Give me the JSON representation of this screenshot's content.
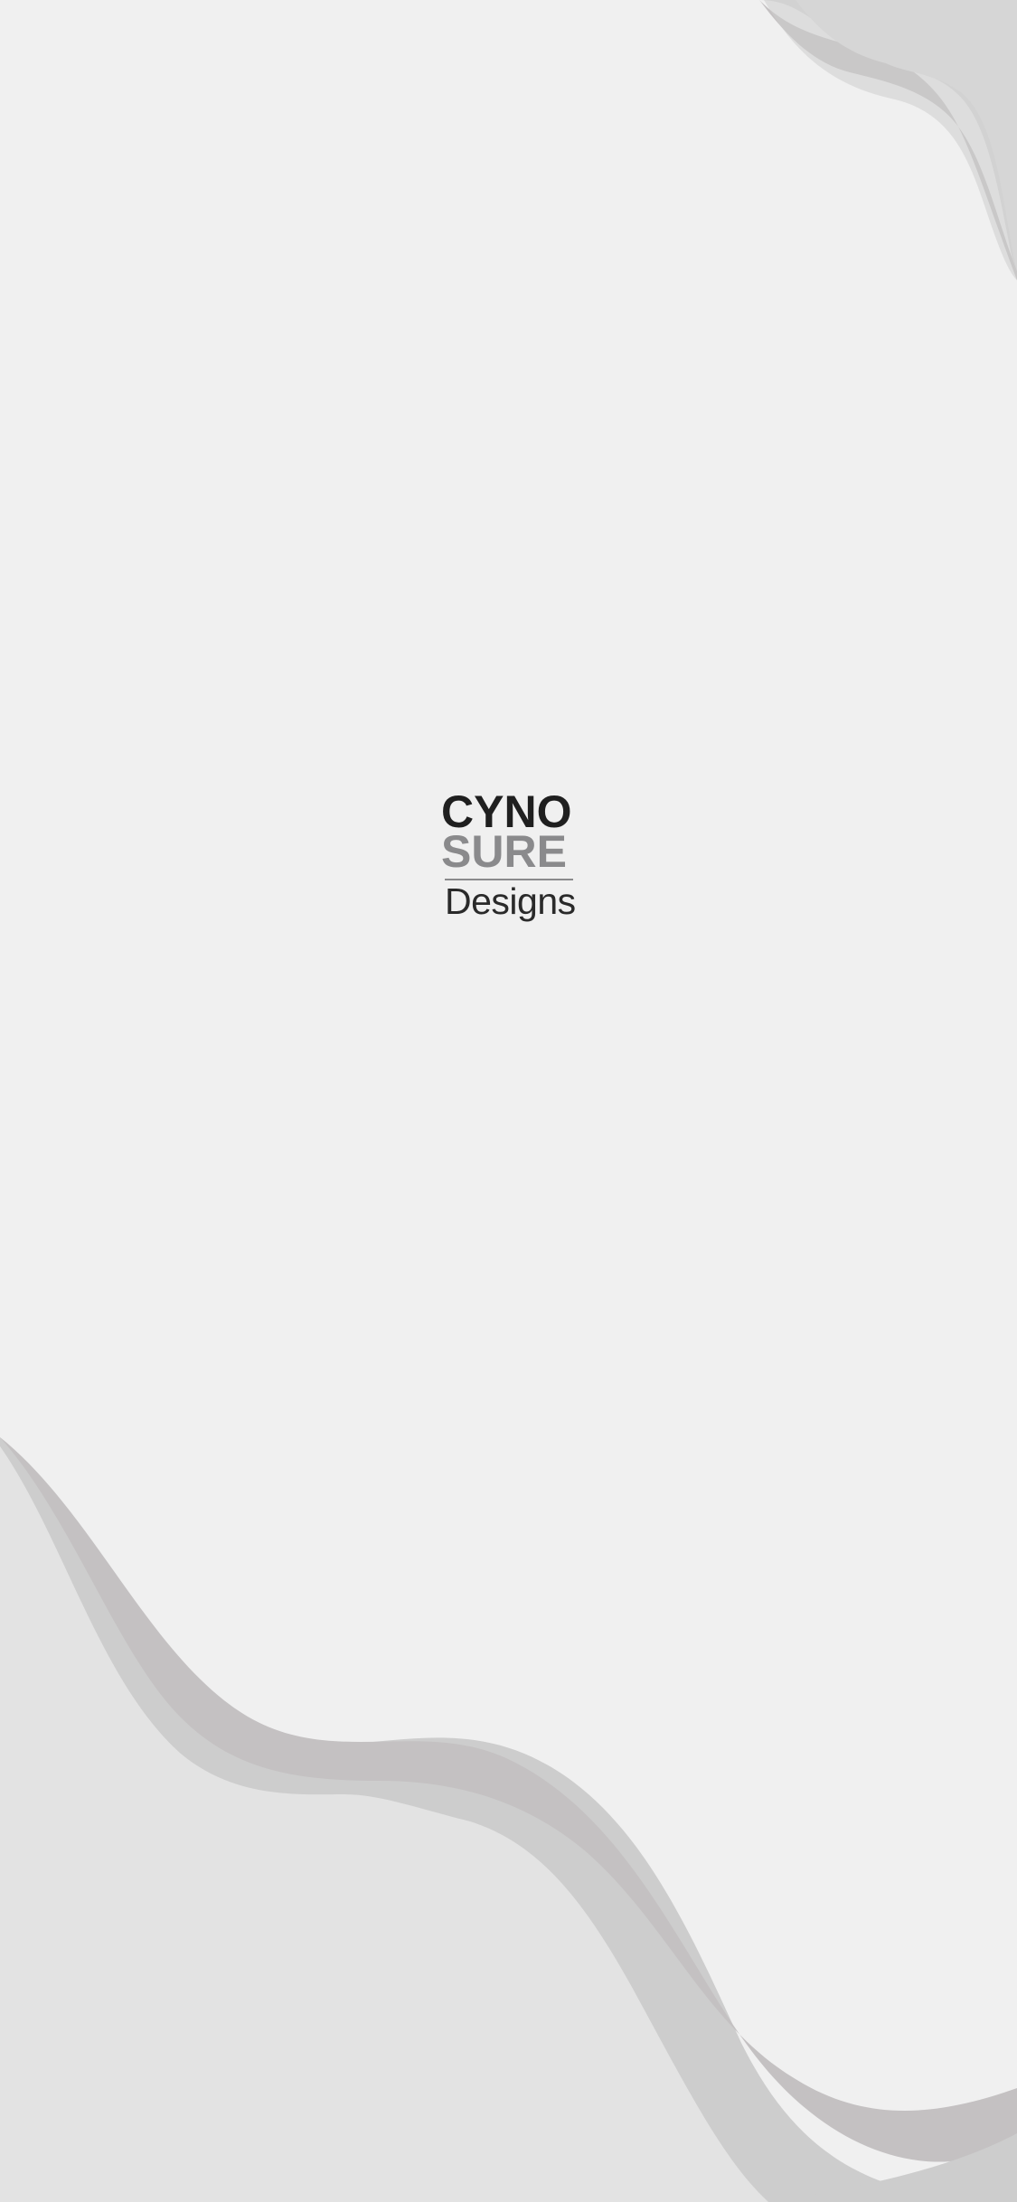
{
  "splash": {
    "logo": {
      "line1": "CYNO",
      "line2": "SURE",
      "line3": "Designs"
    }
  },
  "colors": {
    "background": "#f0f0f0",
    "wave_light": "#e3e3e3",
    "wave_mid": "#cdcdcd",
    "wave_dark": "#c4c1c2",
    "logo_dark": "#1f1f1f",
    "logo_gray": "#8a8a8c"
  }
}
